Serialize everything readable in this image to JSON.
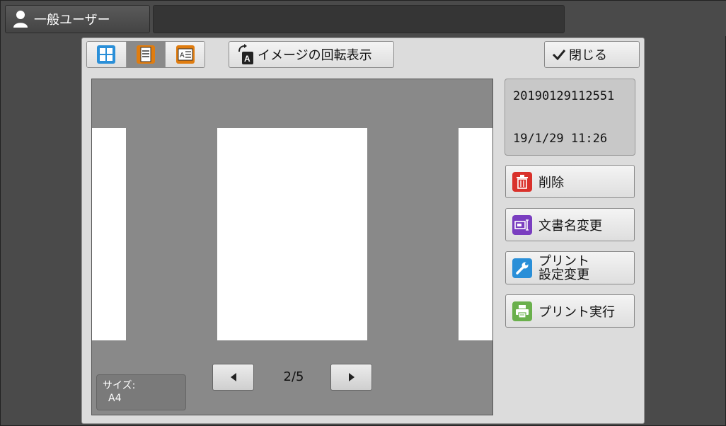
{
  "header": {
    "user_label": "一般ユーザー"
  },
  "toolbar": {
    "rotate_label": "イメージの回転表示",
    "close_label": "閉じる"
  },
  "document": {
    "name": "20190129112551",
    "datetime": "19/1/29 11:26",
    "size_label": "サイズ:",
    "size_value": "A4"
  },
  "pagination": {
    "current": 2,
    "total": 5,
    "display": "2/5"
  },
  "actions": {
    "delete_label": "削除",
    "rename_label": "文書名変更",
    "print_settings_line1": "プリント",
    "print_settings_line2": "設定変更",
    "print_run_label": "プリント実行"
  },
  "icons": {
    "user": "user-icon",
    "grid": "grid-view-icon",
    "page": "single-page-icon",
    "text": "text-view-icon",
    "rotate": "rotate-icon",
    "check": "check-icon",
    "delete": "trash-icon",
    "rename": "rename-icon",
    "settings": "wrench-icon",
    "print": "printer-icon"
  },
  "colors": {
    "grid_icon": "#2a8fd8",
    "page_icon": "#e07d10",
    "delete_icon": "#d9312b",
    "rename_icon": "#7a3ec0",
    "settings_icon": "#2a8fd8",
    "print_icon": "#6ab04c"
  }
}
